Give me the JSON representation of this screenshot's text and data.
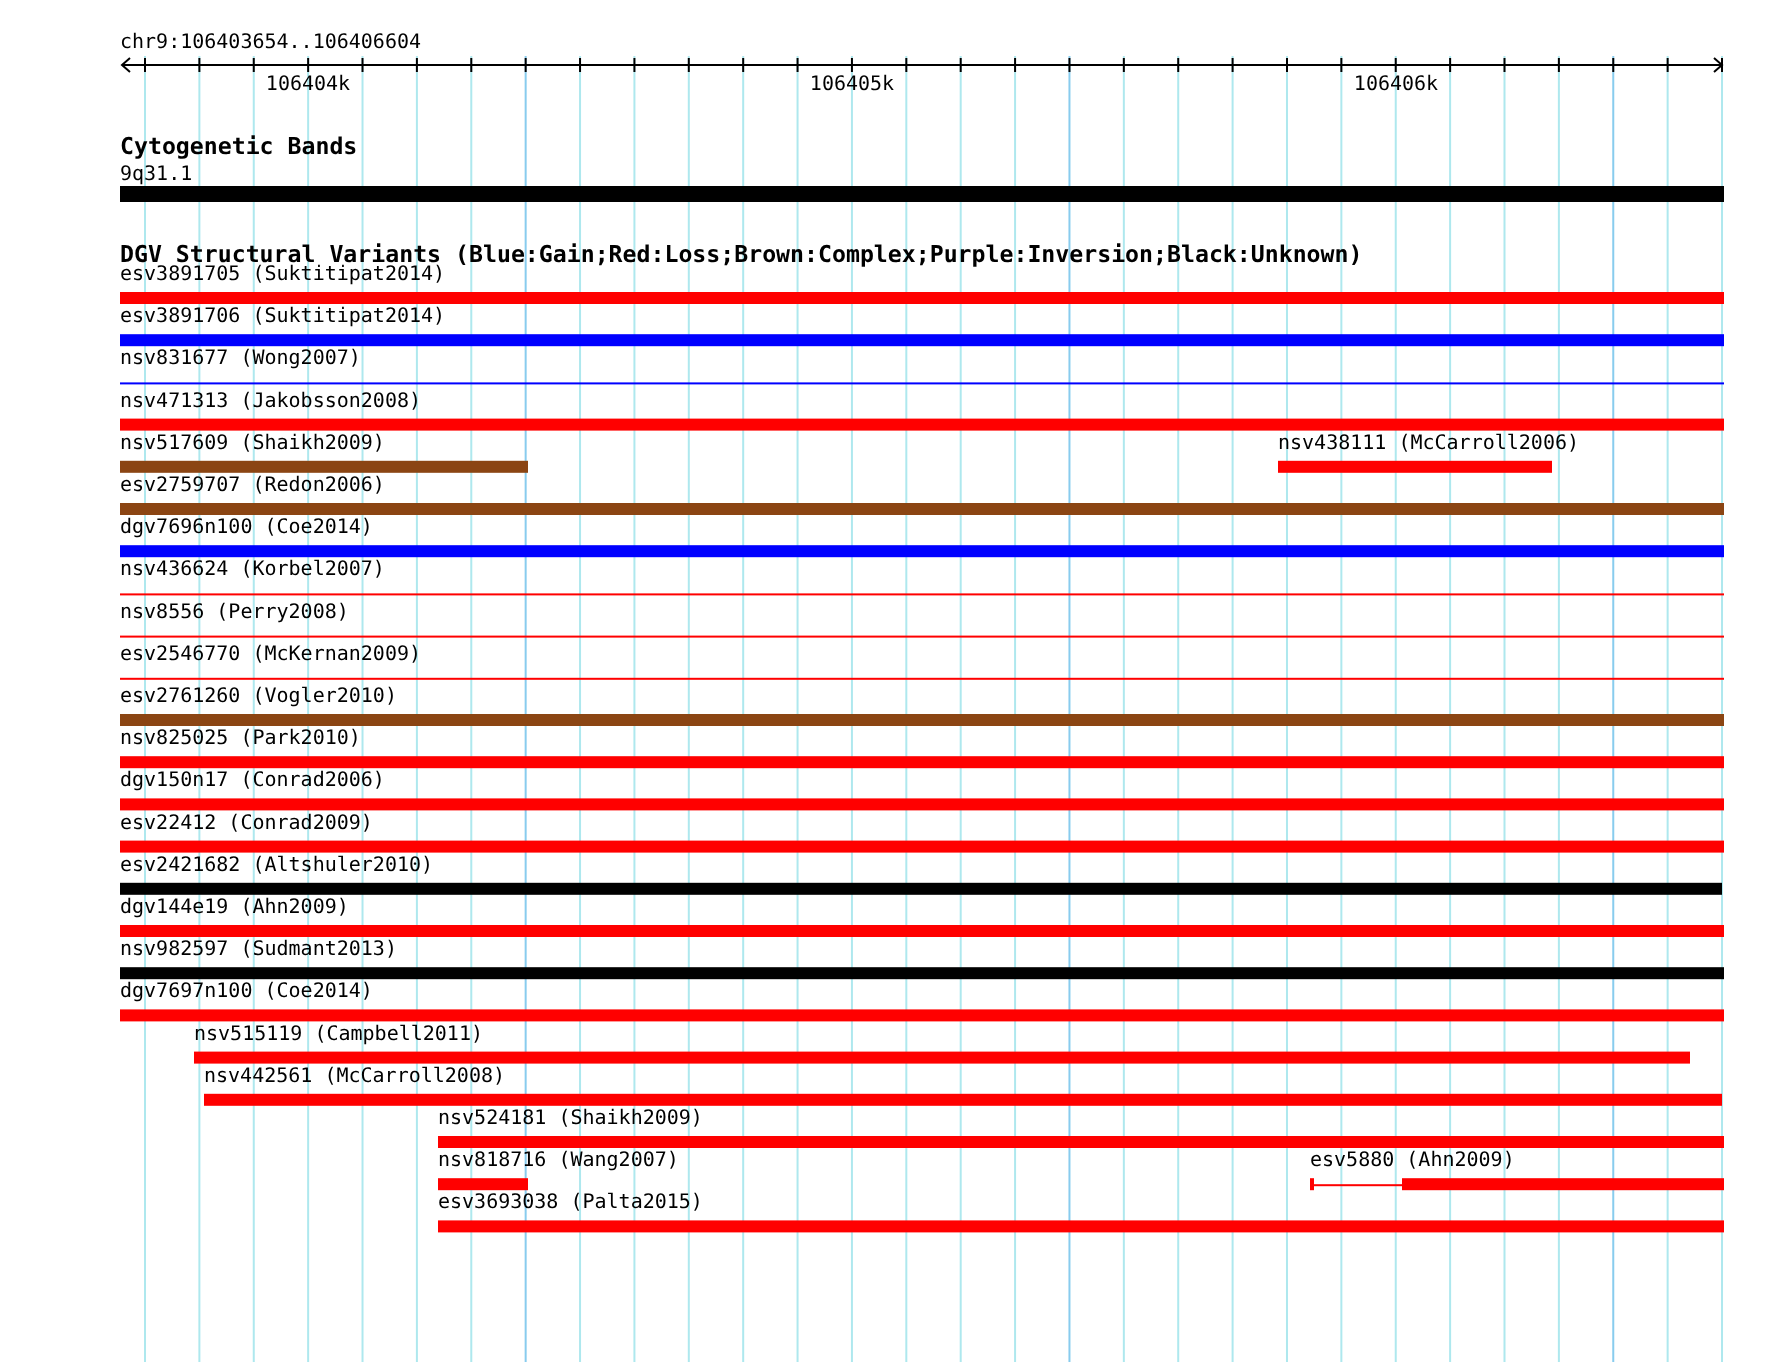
{
  "ruler": {
    "range_label": "chr9:106403654..106406604",
    "tick_labels": [
      "106404k",
      "106405k",
      "106406k"
    ]
  },
  "cytogenetic_track": {
    "title": "Cytogenetic Bands",
    "band": "9q31.1"
  },
  "dgv_track": {
    "title": "DGV Structural Variants (Blue:Gain;Red:Loss;Brown:Complex;Purple:Inversion;Black:Unknown)",
    "rows": [
      {
        "features": [
          {
            "label": "esv3891705 (Suktitipat2014)",
            "color": "#ff0000",
            "kind": "bar"
          }
        ]
      },
      {
        "features": [
          {
            "label": "esv3891706 (Suktitipat2014)",
            "color": "#0000ff",
            "kind": "bar"
          }
        ]
      },
      {
        "features": [
          {
            "label": "nsv831677 (Wong2007)",
            "color": "#0000ff",
            "kind": "line"
          }
        ]
      },
      {
        "features": [
          {
            "label": "nsv471313 (Jakobsson2008)",
            "color": "#ff0000",
            "kind": "bar"
          }
        ]
      },
      {
        "features": [
          {
            "label": "nsv517609 (Shaikh2009)",
            "color": "#8b4513",
            "kind": "bar"
          },
          {
            "label": "nsv438111 (McCarroll2006)",
            "color": "#ff0000",
            "kind": "bar"
          }
        ]
      },
      {
        "features": [
          {
            "label": "esv2759707 (Redon2006)",
            "color": "#8b4513",
            "kind": "bar"
          }
        ]
      },
      {
        "features": [
          {
            "label": "dgv7696n100 (Coe2014)",
            "color": "#0000ff",
            "kind": "bar"
          }
        ]
      },
      {
        "features": [
          {
            "label": "nsv436624 (Korbel2007)",
            "color": "#ff0000",
            "kind": "line"
          }
        ]
      },
      {
        "features": [
          {
            "label": "nsv8556 (Perry2008)",
            "color": "#ff0000",
            "kind": "line"
          }
        ]
      },
      {
        "features": [
          {
            "label": "esv2546770 (McKernan2009)",
            "color": "#ff0000",
            "kind": "line"
          }
        ]
      },
      {
        "features": [
          {
            "label": "esv2761260 (Vogler2010)",
            "color": "#8b4513",
            "kind": "bar"
          }
        ]
      },
      {
        "features": [
          {
            "label": "nsv825025 (Park2010)",
            "color": "#ff0000",
            "kind": "bar"
          }
        ]
      },
      {
        "features": [
          {
            "label": "dgv150n17 (Conrad2006)",
            "color": "#ff0000",
            "kind": "bar"
          }
        ]
      },
      {
        "features": [
          {
            "label": "esv22412 (Conrad2009)",
            "color": "#ff0000",
            "kind": "bar"
          }
        ]
      },
      {
        "features": [
          {
            "label": "esv2421682 (Altshuler2010)",
            "color": "#000000",
            "kind": "bar"
          }
        ]
      },
      {
        "features": [
          {
            "label": "dgv144e19 (Ahn2009)",
            "color": "#ff0000",
            "kind": "bar"
          }
        ]
      },
      {
        "features": [
          {
            "label": "nsv982597 (Sudmant2013)",
            "color": "#000000",
            "kind": "bar"
          }
        ]
      },
      {
        "features": [
          {
            "label": "dgv7697n100 (Coe2014)",
            "color": "#ff0000",
            "kind": "bar"
          }
        ]
      },
      {
        "features": [
          {
            "label": "nsv515119 (Campbell2011)",
            "color": "#ff0000",
            "kind": "bar"
          }
        ]
      },
      {
        "features": [
          {
            "label": "nsv442561 (McCarroll2008)",
            "color": "#ff0000",
            "kind": "bar"
          }
        ]
      },
      {
        "features": [
          {
            "label": "nsv524181 (Shaikh2009)",
            "color": "#ff0000",
            "kind": "bar"
          }
        ]
      },
      {
        "features": [
          {
            "label": "nsv818716 (Wang2007)",
            "color": "#ff0000",
            "kind": "bar"
          },
          {
            "label": "esv5880 (Ahn2009)",
            "color": "#ff0000",
            "kind": "split"
          }
        ]
      },
      {
        "features": [
          {
            "label": "esv3693038 (Palta2015)",
            "color": "#ff0000",
            "kind": "bar"
          }
        ]
      }
    ]
  }
}
